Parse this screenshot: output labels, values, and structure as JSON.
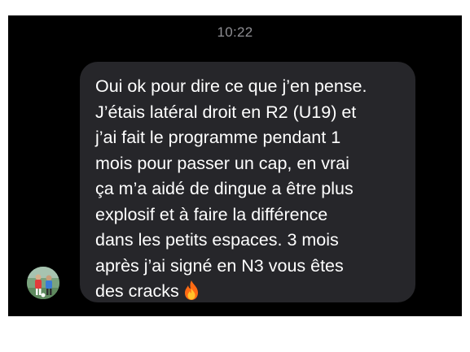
{
  "status_bar": {
    "time": "10:22"
  },
  "message": {
    "lines": [
      "Oui ok pour dire ce que j’en pense.",
      "J’étais latéral droit en R2 (U19) et",
      "j’ai fait le programme pendant 1",
      "mois pour passer un cap, en vrai",
      "ça m’a aidé de dingue a être plus",
      "explosif et à faire la différence",
      "dans les petits espaces. 3 mois",
      "après j’ai signé en N3 vous êtes",
      "des cracks"
    ],
    "emoji": "fire-icon"
  },
  "avatar": {
    "icon": "avatar-photo"
  },
  "colors": {
    "background": "#000000",
    "bubble": "#26262a",
    "text": "#ffffff",
    "timestamp": "#8e8e93"
  }
}
